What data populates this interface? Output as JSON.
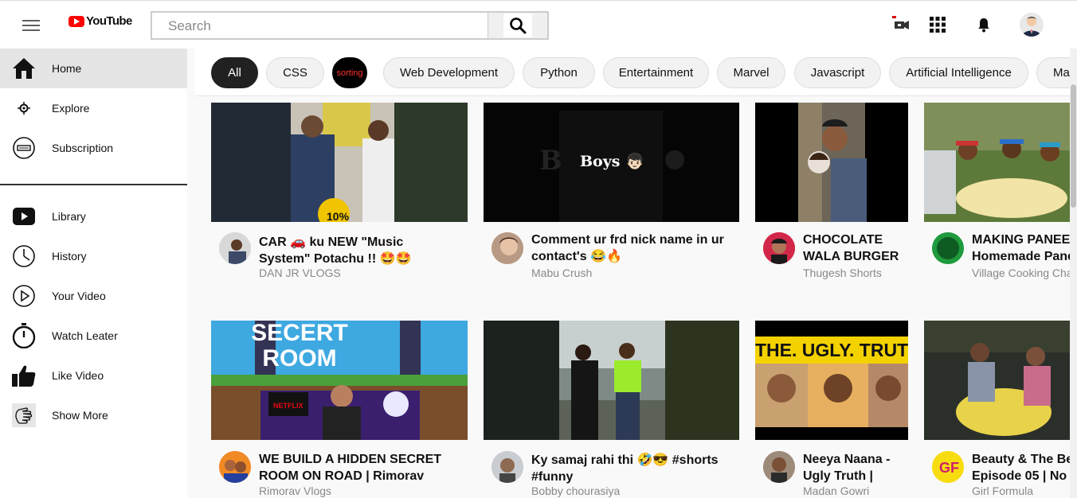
{
  "header": {
    "logo_text": "YouTube",
    "search_placeholder": "Search"
  },
  "icons": {
    "menu": "hamburger-icon",
    "search": "magnifier-icon",
    "create": "video-camera-icon",
    "apps": "grid-icon",
    "notifications": "bell-icon",
    "avatar": "user-avatar"
  },
  "sidebar": {
    "items": [
      {
        "label": "Home",
        "icon": "home-icon"
      },
      {
        "label": "Explore",
        "icon": "compass-icon"
      },
      {
        "label": "Subscription",
        "icon": "subscription-icon"
      },
      {
        "label": "Library",
        "icon": "library-icon"
      },
      {
        "label": "History",
        "icon": "clock-icon"
      },
      {
        "label": "Your Video",
        "icon": "play-icon"
      },
      {
        "label": "Watch Leater",
        "icon": "timer-icon"
      },
      {
        "label": "Like Video",
        "icon": "thumbs-up-icon"
      },
      {
        "label": "Show More",
        "icon": "hand-icon"
      }
    ]
  },
  "chips": [
    "All",
    "CSS",
    "sorting",
    "Web Development",
    "Python",
    "Entertainment",
    "Marvel",
    "Javascript",
    "Artificial Intelligence",
    "Ma"
  ],
  "videos": [
    {
      "title": "CAR 🚗 ku NEW \"Music System\" Potachu !! 🤩🤩",
      "channel": "DAN JR VLOGS"
    },
    {
      "title": "Comment ur frd nick name in ur contact's 😂🔥",
      "channel": "Mabu Crush",
      "thumb_text": "Boys 👦🏻"
    },
    {
      "title": "CHOCOLATE WALA BURGER",
      "channel": "Thugesh Shorts"
    },
    {
      "title": "MAKING PANEE Homemade Pane",
      "channel": "Village Cooking Cha"
    },
    {
      "title": "WE BUILD A HIDDEN SECRET ROOM ON ROAD | Rimorav",
      "channel": "Rimorav Vlogs",
      "thumb_text": "SECERT ROOM"
    },
    {
      "title": "Ky samaj rahi thi 🤣😎 #shorts #funny",
      "channel": "Bobby chourasiya"
    },
    {
      "title": "Neeya Naana - Ugly Truth |",
      "channel": "Madan Gowri",
      "thumb_text": "THE. UGLY. TRUTH"
    },
    {
      "title": "Beauty & The Be Episode 05 | No",
      "channel": "Girl Formula"
    }
  ],
  "colors": {
    "brand_red": "#ff0000",
    "chip_active": "#212121",
    "sidebar_active": "#e5e5e5"
  }
}
